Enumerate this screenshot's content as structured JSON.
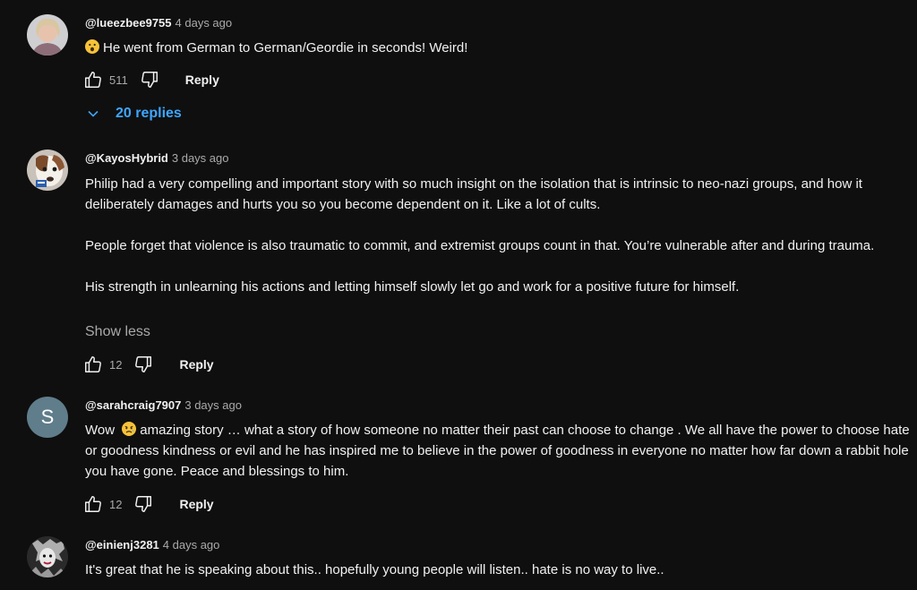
{
  "comments": [
    {
      "handle": "@lueezbee9755",
      "time": "4 days ago",
      "emoji": "astonished-face",
      "paragraphs": [
        "He went from German to German/Geordie in seconds! Weird!"
      ],
      "likes": "511",
      "reply_label": "Reply",
      "replies_label": "20 replies"
    },
    {
      "handle": "@KayosHybrid",
      "time": "3 days ago",
      "paragraphs": [
        "Philip had a very compelling and important story with so much insight on the isolation that is intrinsic to neo-nazi groups, and how it deliberately damages and hurts you so you become dependent on it.  Like a lot of cults.",
        "People forget that violence is also traumatic to commit, and extremist groups count in that. You’re vulnerable after and during trauma.",
        "His strength in unlearning his actions and letting himself slowly let go and work for a positive future for himself."
      ],
      "show_less_label": "Show less",
      "likes": "12",
      "reply_label": "Reply"
    },
    {
      "handle": "@sarahcraig7907",
      "time": "3 days ago",
      "avatar_letter": "S",
      "text_before_emoji": "Wow",
      "emoji": "sad-but-relieved-face",
      "text_after_emoji": "amazing story … what a story of how someone no matter their past can choose to change . We all have the power to choose hate or goodness kindness or evil and he has inspired me to believe in the power of goodness in everyone no matter how far down a rabbit hole you have gone. Peace and blessings to him.",
      "likes": "12",
      "reply_label": "Reply"
    },
    {
      "handle": "@einienj3281",
      "time": "4 days ago",
      "paragraphs": [
        "It's great that he is speaking about this..  hopefully young people will listen.. hate is no way to live.."
      ]
    }
  ],
  "colors": {
    "background": "#0f0f0f",
    "text": "#f1f1f1",
    "secondary_text": "#aaaaaa",
    "link": "#3ea6ff",
    "avatar_s_bg": "#607d8b"
  }
}
